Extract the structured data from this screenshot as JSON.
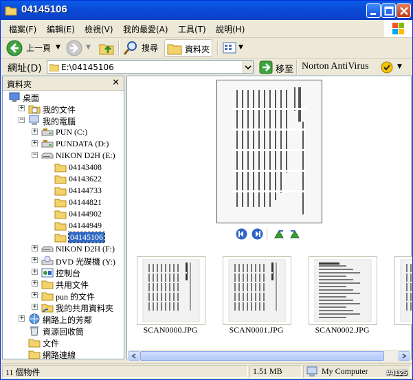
{
  "window": {
    "title": "04145106",
    "buttons": [
      "minimize-icon",
      "maximize-icon",
      "close-icon"
    ]
  },
  "menu": {
    "items": [
      "檔案(F)",
      "編輯(E)",
      "檢視(V)",
      "我的最愛(A)",
      "工具(T)",
      "說明(H)"
    ]
  },
  "toolbar": {
    "back_label": "上一頁",
    "search_label": "搜尋",
    "folders_label": "資料夾"
  },
  "address": {
    "label": "網址(D)",
    "value": "E:\\04145106",
    "go_label": "移至",
    "norton_label": "Norton AntiVirus"
  },
  "sidebar": {
    "title": "資料夾",
    "close": "✕",
    "tree": [
      {
        "label": "桌面",
        "icon": "desktop-icon"
      },
      {
        "label": "我的文件",
        "icon": "documents-icon"
      },
      {
        "label": "我的電腦",
        "icon": "computer-icon"
      },
      {
        "label": "PUN (C:)",
        "icon": "drive-icon"
      },
      {
        "label": "PUNDATA (D:)",
        "icon": "drive-icon"
      },
      {
        "label": "NIKON D2H (E:)",
        "icon": "removable-drive-icon"
      },
      {
        "label": "04143408",
        "icon": "folder-icon"
      },
      {
        "label": "04143622",
        "icon": "folder-icon"
      },
      {
        "label": "04144733",
        "icon": "folder-icon"
      },
      {
        "label": "04144821",
        "icon": "folder-icon"
      },
      {
        "label": "04144902",
        "icon": "folder-icon"
      },
      {
        "label": "04144949",
        "icon": "folder-icon"
      },
      {
        "label": "04145106",
        "icon": "folder-icon",
        "selected": true
      },
      {
        "label": "NIKON D2H (F:)",
        "icon": "removable-drive-icon"
      },
      {
        "label": "DVD 光碟機 (Y:)",
        "icon": "dvd-drive-icon"
      },
      {
        "label": "控制台",
        "icon": "control-panel-icon"
      },
      {
        "label": "共用文件",
        "icon": "folder-icon"
      },
      {
        "label": "pun 的文件",
        "icon": "folder-icon"
      },
      {
        "label": "我的共用資料夾",
        "icon": "shared-folder-icon"
      },
      {
        "label": "網路上的芳鄰",
        "icon": "network-icon"
      },
      {
        "label": "資源回收筒",
        "icon": "recycle-bin-icon"
      },
      {
        "label": "文件",
        "icon": "folder-icon"
      },
      {
        "label": "網路連線",
        "icon": "folder-icon"
      }
    ]
  },
  "content": {
    "files": [
      "SCAN0000.JPG",
      "SCAN0001.JPG",
      "SCAN0002.JPG",
      "SC"
    ]
  },
  "status": {
    "count": "11 個物件",
    "size": "1.51 MB",
    "location": "My Computer"
  },
  "watermark": "#4125",
  "colors": {
    "title_blue": "#0b4ad6",
    "selection": "#316ac5",
    "face": "#ece9d8"
  }
}
